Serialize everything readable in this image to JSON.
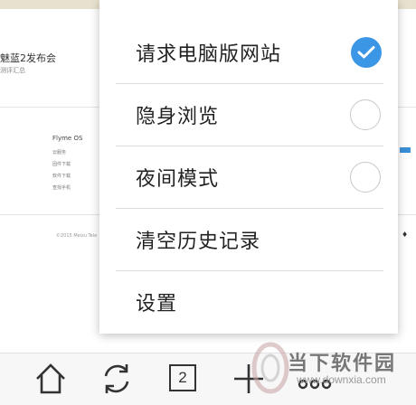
{
  "background_page": {
    "headline": "魅蓝2发布会",
    "subline": "测评汇总",
    "footer_title": "Flyme OS",
    "footer_items": [
      "云服务",
      "固件下载",
      "软件下载",
      "查找手机"
    ],
    "copyright": "©2015 Meizu Tele"
  },
  "menu": {
    "items": [
      {
        "label": "请求电脑版网站",
        "toggle": "checked"
      },
      {
        "label": "隐身浏览",
        "toggle": "unchecked"
      },
      {
        "label": "夜间模式",
        "toggle": "unchecked"
      },
      {
        "label": "清空历史记录"
      },
      {
        "label": "设置"
      }
    ],
    "accent_color": "#3b97e6"
  },
  "toolbar": {
    "icons": [
      "home-icon",
      "refresh-icon",
      "tabs-icon",
      "new-tab-plus-icon",
      "more-dots-icon"
    ],
    "tab_count": "2"
  },
  "watermark": {
    "main": "当下软件园",
    "sub": "www.downxia.com"
  }
}
